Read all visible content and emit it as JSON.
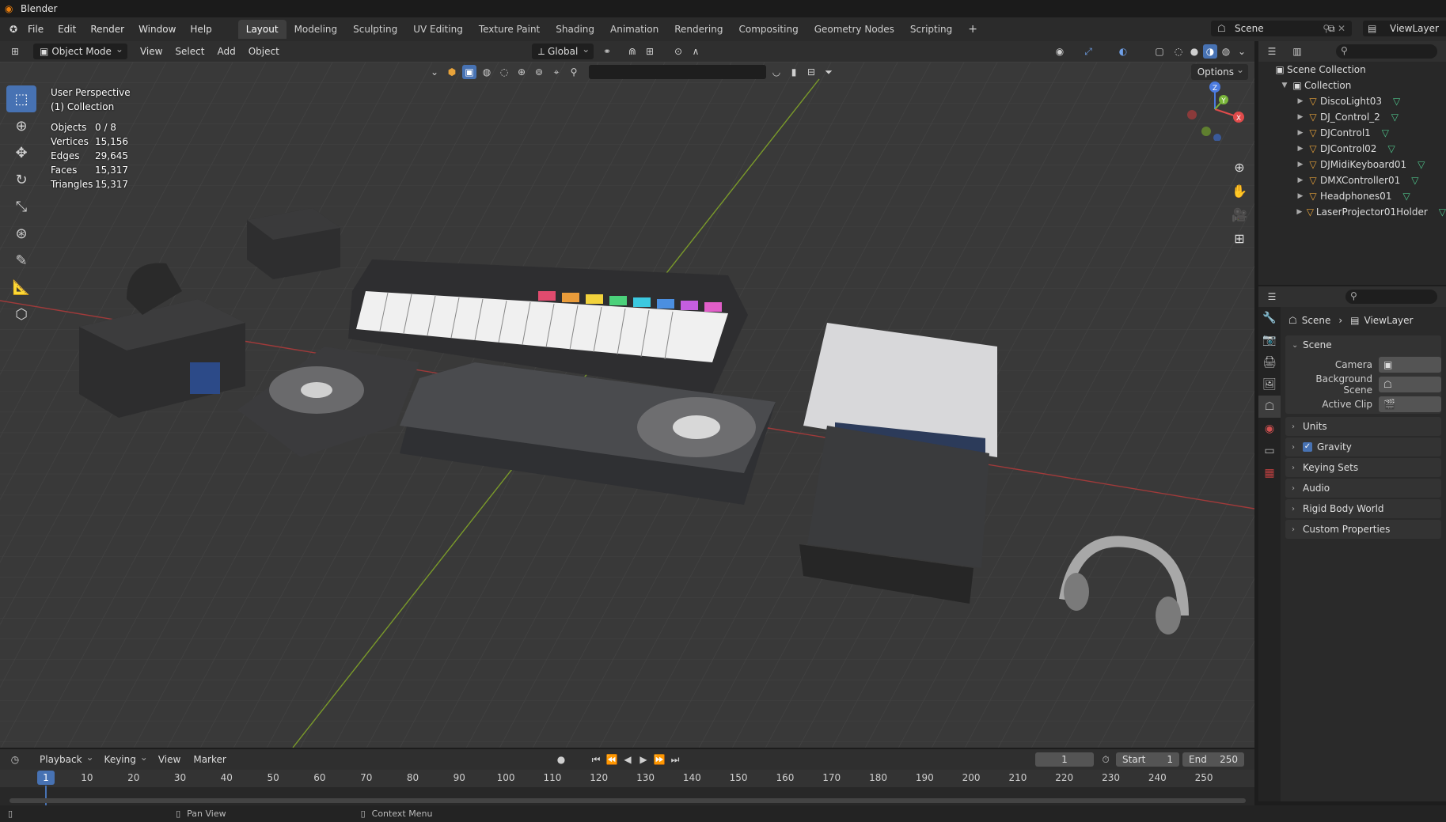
{
  "window": {
    "title": "Blender"
  },
  "topbar": {
    "menus": [
      "File",
      "Edit",
      "Render",
      "Window",
      "Help"
    ],
    "workspaces": [
      "Layout",
      "Modeling",
      "Sculpting",
      "UV Editing",
      "Texture Paint",
      "Shading",
      "Animation",
      "Rendering",
      "Compositing",
      "Geometry Nodes",
      "Scripting"
    ],
    "active_workspace": "Layout",
    "scene": "Scene",
    "view_layer": "ViewLayer"
  },
  "viewport_header": {
    "mode": "Object Mode",
    "menus": [
      "View",
      "Select",
      "Add",
      "Object"
    ],
    "transform_orientation": "Global",
    "options_label": "Options"
  },
  "viewport_overlay": {
    "perspective": "User Perspective",
    "collection": "(1) Collection",
    "stats": [
      {
        "label": "Objects",
        "value": "0 / 8"
      },
      {
        "label": "Vertices",
        "value": "15,156"
      },
      {
        "label": "Edges",
        "value": "29,645"
      },
      {
        "label": "Faces",
        "value": "15,317"
      },
      {
        "label": "Triangles",
        "value": "15,317"
      }
    ]
  },
  "outliner": {
    "root": "Scene Collection",
    "collection": "Collection",
    "objects": [
      "DiscoLight03",
      "DJ_Control_2",
      "DJControl1",
      "DJControl02",
      "DJMidiKeyboard01",
      "DMXController01",
      "Headphones01",
      "LaserProjector01Holder"
    ]
  },
  "properties": {
    "breadcrumb_scene": "Scene",
    "breadcrumb_layer": "ViewLayer",
    "scene_panel": {
      "title": "Scene",
      "rows": [
        {
          "label": "Camera"
        },
        {
          "label": "Background Scene"
        },
        {
          "label": "Active Clip"
        }
      ]
    },
    "subpanels": [
      "Units",
      "Gravity",
      "Keying Sets",
      "Audio",
      "Rigid Body World",
      "Custom Properties"
    ]
  },
  "timeline": {
    "menus": [
      "Playback",
      "Keying",
      "View",
      "Marker"
    ],
    "current_frame": "1",
    "start_label": "Start",
    "start": "1",
    "end_label": "End",
    "end": "250",
    "ruler": [
      "10",
      "20",
      "30",
      "40",
      "50",
      "60",
      "70",
      "80",
      "90",
      "100",
      "110",
      "120",
      "130",
      "140",
      "150",
      "160",
      "170",
      "180",
      "190",
      "200",
      "210",
      "220",
      "230",
      "240",
      "250"
    ]
  },
  "statusbar": {
    "hint1": "Pan View",
    "hint2": "Context Menu"
  },
  "colors": {
    "accent": "#4772b3",
    "object_icon": "#e8a33a",
    "mesh_icon": "#4ec28a"
  }
}
